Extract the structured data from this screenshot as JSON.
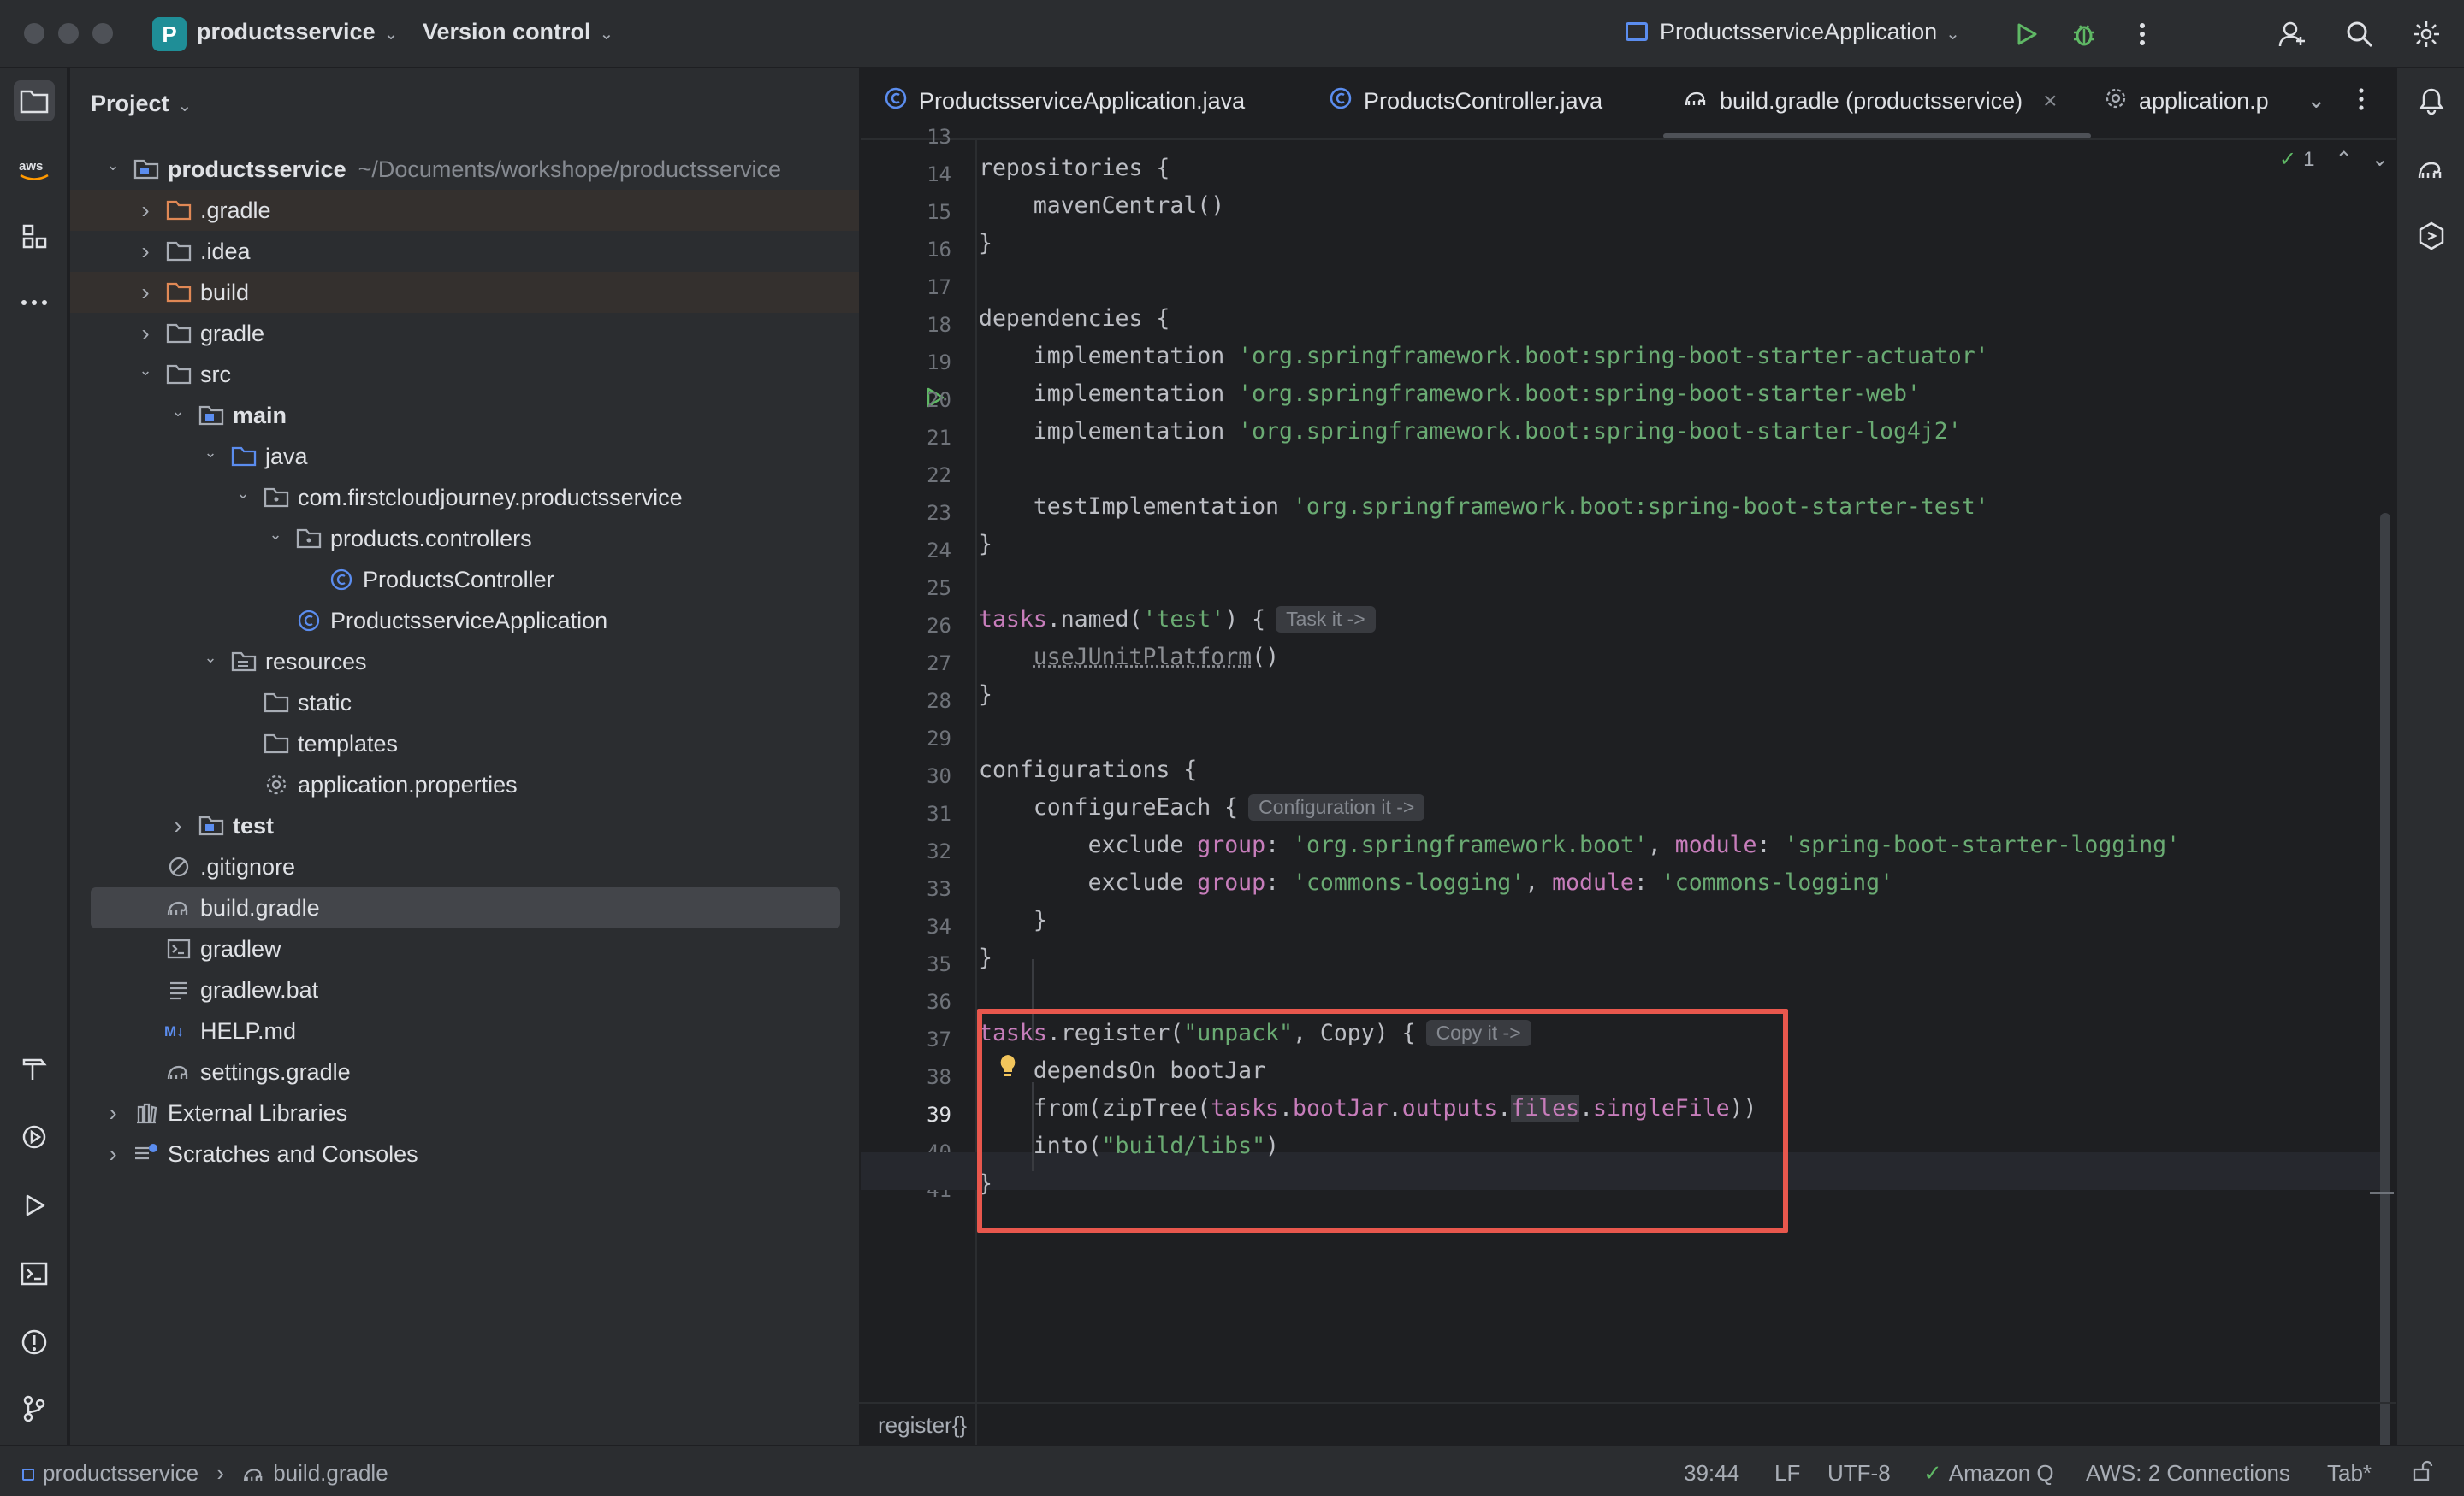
{
  "titlebar": {
    "project_badge": "P",
    "project_name": "productsservice",
    "version_control": "Version control",
    "run_config": "ProductsserviceApplication"
  },
  "project_panel": {
    "title": "Project",
    "tree": [
      {
        "label": "productsservice",
        "path": "~/Documents/workshope/productsservice",
        "indent": 0,
        "arrow": "open",
        "icon": "module-folder-icon",
        "bold": true
      },
      {
        "label": ".gradle",
        "indent": 1,
        "arrow": "closed",
        "icon": "folder-orange-icon",
        "hl": true
      },
      {
        "label": ".idea",
        "indent": 1,
        "arrow": "closed",
        "icon": "folder-icon"
      },
      {
        "label": "build",
        "indent": 1,
        "arrow": "closed",
        "icon": "folder-orange-icon",
        "hl": true
      },
      {
        "label": "gradle",
        "indent": 1,
        "arrow": "closed",
        "icon": "folder-icon"
      },
      {
        "label": "src",
        "indent": 1,
        "arrow": "open",
        "icon": "folder-icon"
      },
      {
        "label": "main",
        "indent": 2,
        "arrow": "open",
        "icon": "module-folder-icon",
        "bold": true
      },
      {
        "label": "java",
        "indent": 3,
        "arrow": "open",
        "icon": "source-folder-icon"
      },
      {
        "label": "com.firstcloudjourney.productsservice",
        "indent": 4,
        "arrow": "open",
        "icon": "package-icon"
      },
      {
        "label": "products.controllers",
        "indent": 5,
        "arrow": "open",
        "icon": "package-icon"
      },
      {
        "label": "ProductsController",
        "indent": 6,
        "arrow": "none",
        "icon": "class-icon"
      },
      {
        "label": "ProductsserviceApplication",
        "indent": 5,
        "arrow": "none",
        "icon": "class-icon"
      },
      {
        "label": "resources",
        "indent": 3,
        "arrow": "open",
        "icon": "resources-folder-icon"
      },
      {
        "label": "static",
        "indent": 4,
        "arrow": "none",
        "icon": "folder-icon"
      },
      {
        "label": "templates",
        "indent": 4,
        "arrow": "none",
        "icon": "folder-icon"
      },
      {
        "label": "application.properties",
        "indent": 4,
        "arrow": "none",
        "icon": "settings-file-icon"
      },
      {
        "label": "test",
        "indent": 2,
        "arrow": "closed",
        "icon": "module-folder-icon",
        "bold": true
      },
      {
        "label": ".gitignore",
        "indent": 1,
        "arrow": "none",
        "icon": "gitignore-icon"
      },
      {
        "label": "build.gradle",
        "indent": 1,
        "arrow": "none",
        "icon": "gradle-icon",
        "sel": true
      },
      {
        "label": "gradlew",
        "indent": 1,
        "arrow": "none",
        "icon": "terminal-file-icon"
      },
      {
        "label": "gradlew.bat",
        "indent": 1,
        "arrow": "none",
        "icon": "text-file-icon"
      },
      {
        "label": "HELP.md",
        "indent": 1,
        "arrow": "none",
        "icon": "markdown-icon"
      },
      {
        "label": "settings.gradle",
        "indent": 1,
        "arrow": "none",
        "icon": "gradle-icon"
      },
      {
        "label": "External Libraries",
        "indent": 0,
        "arrow": "closed",
        "icon": "libraries-icon"
      },
      {
        "label": "Scratches and Consoles",
        "indent": 0,
        "arrow": "closed",
        "icon": "scratches-icon"
      }
    ]
  },
  "editor": {
    "tabs": [
      {
        "label": "ProductsserviceApplication.java",
        "icon": "class-icon"
      },
      {
        "label": "ProductsController.java",
        "icon": "class-icon"
      },
      {
        "label": "build.gradle (productsservice)",
        "icon": "gradle-icon",
        "active": true,
        "close": "×"
      },
      {
        "label": "application.p",
        "icon": "settings-file-icon"
      }
    ],
    "inspection_count": "1",
    "breadcrumb": "register{}"
  },
  "code_lines": [
    {
      "n": "13"
    },
    {
      "n": "14"
    },
    {
      "n": "15"
    },
    {
      "n": "16"
    },
    {
      "n": "17"
    },
    {
      "n": "18"
    },
    {
      "n": "19"
    },
    {
      "n": "20"
    },
    {
      "n": "21"
    },
    {
      "n": "22"
    },
    {
      "n": "23"
    },
    {
      "n": "24"
    },
    {
      "n": "25"
    },
    {
      "n": "26"
    },
    {
      "n": "27"
    },
    {
      "n": "28"
    },
    {
      "n": "29"
    },
    {
      "n": "30"
    },
    {
      "n": "31"
    },
    {
      "n": "32"
    },
    {
      "n": "33"
    },
    {
      "n": "34"
    },
    {
      "n": "35"
    },
    {
      "n": "36"
    },
    {
      "n": "37"
    },
    {
      "n": "38"
    },
    {
      "n": "39"
    },
    {
      "n": "40"
    },
    {
      "n": "41"
    }
  ],
  "code": {
    "l14": "repositories {",
    "l15": "    mavenCentral()",
    "l16": "}",
    "l18": "dependencies {",
    "l19_a": "    implementation ",
    "l19_b": "'org.springframework.boot:spring-boot-starter-actuator'",
    "l20_a": "    implementation ",
    "l20_b": "'org.springframework.boot:spring-boot-starter-web'",
    "l21_a": "    implementation ",
    "l21_b": "'org.springframework.boot:spring-boot-starter-log4j2'",
    "l23_a": "    testImplementation ",
    "l23_b": "'org.springframework.boot:spring-boot-starter-test'",
    "l24": "}",
    "l26_a": "tasks",
    "l26_b": ".named(",
    "l26_c": "'test'",
    "l26_d": ") {",
    "l26_hint": "Task it ->",
    "l27_a": "    ",
    "l27_b": "useJUnitPlatform",
    "l27_c": "()",
    "l28": "}",
    "l30": "configurations {",
    "l31_a": "    configureEach {",
    "l31_hint": "Configuration it ->",
    "l32_a": "        exclude ",
    "l32_b": "group",
    "l32_c": ": ",
    "l32_d": "'org.springframework.boot'",
    "l32_e": ", ",
    "l32_f": "module",
    "l32_g": ": ",
    "l32_h": "'spring-boot-starter-logging'",
    "l33_a": "        exclude ",
    "l33_b": "group",
    "l33_c": ": ",
    "l33_d": "'commons-logging'",
    "l33_e": ", ",
    "l33_f": "module",
    "l33_g": ": ",
    "l33_h": "'commons-logging'",
    "l34": "    }",
    "l35": "}",
    "l37_a": "tasks",
    "l37_b": ".register(",
    "l37_c": "\"unpack\"",
    "l37_d": ", Copy) {",
    "l37_hint": "Copy it ->",
    "l38": "    dependsOn bootJar",
    "l39_a": "    from(zipTree(",
    "l39_b": "tasks",
    "l39_c": ".",
    "l39_d": "bootJar",
    "l39_e": ".",
    "l39_f": "outputs",
    "l39_g": ".",
    "l39_h": "files",
    "l39_i": ".",
    "l39_j": "singleFile",
    "l39_k": "))",
    "l40_a": "    into(",
    "l40_b": "\"build/libs\"",
    "l40_c": ")",
    "l41": "}"
  },
  "statusbar": {
    "crumb_project": "productsservice",
    "crumb_sep": "›",
    "crumb_file": "build.gradle",
    "position": "39:44",
    "line_sep": "LF",
    "encoding": "UTF-8",
    "amazon_q": "Amazon Q",
    "aws": "AWS: 2 Connections",
    "indent": "Tab*"
  },
  "colors": {
    "accent_red_box": "#e8574d",
    "string": "#6aab73",
    "keyword": "#c77dbb",
    "background": "#1e1f22",
    "panel": "#2b2d30"
  }
}
